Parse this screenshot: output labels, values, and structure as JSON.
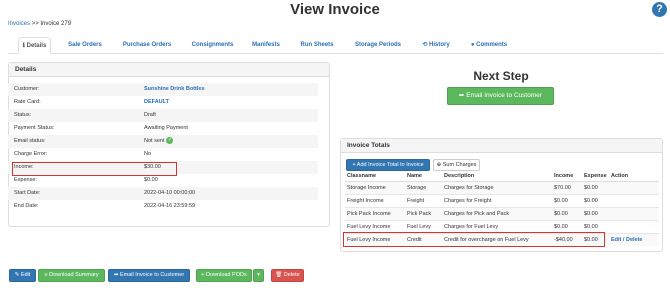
{
  "page": {
    "title": "View Invoice",
    "help_icon": "?"
  },
  "breadcrumb": {
    "root": "Invoices",
    "separator": ">>",
    "current": "Invoice 279"
  },
  "tabs": [
    {
      "icon": "ℹ",
      "label": "Details",
      "active": true
    },
    {
      "label": "Sale Orders"
    },
    {
      "label": "Purchase Orders"
    },
    {
      "label": "Consignments"
    },
    {
      "label": "Manifests"
    },
    {
      "label": "Run Sheets"
    },
    {
      "label": "Storage Periods"
    },
    {
      "icon": "⟲",
      "label": "History"
    },
    {
      "icon": "●",
      "label": "Comments"
    }
  ],
  "details": {
    "heading": "Details",
    "rows": [
      {
        "label": "Customer:",
        "value": "Sunshine Drink Bottles",
        "link": true
      },
      {
        "label": "Rate Card:",
        "value": "DEFAULT",
        "link": true
      },
      {
        "label": "Status:",
        "value": "Draft"
      },
      {
        "label": "Payment Status:",
        "value": "Awaiting Payment"
      },
      {
        "label": "Email status:",
        "value": "Not sent",
        "icon": "check-circle-icon",
        "icon_color": "#5cb85c"
      },
      {
        "label": "Charge Error:",
        "value": "No"
      },
      {
        "label": "Income:",
        "value": "$30.00",
        "highlighted": true
      },
      {
        "label": "Expense:",
        "value": "$0.00"
      },
      {
        "label": "Start Date:",
        "value": "2022-04-10 00:00:00"
      },
      {
        "label": "End Date:",
        "value": "2022-04-16 23:59:59"
      }
    ]
  },
  "next_step": {
    "heading": "Next Step",
    "button_label": "Email Invoice to Customer"
  },
  "invoice_totals": {
    "heading": "Invoice Totals",
    "add_button": "Add Invoice Total to Invoice",
    "sum_button": "Sum Charges",
    "columns": [
      "Classname",
      "Name",
      "Description",
      "Income",
      "Expense",
      "Action"
    ],
    "rows": [
      {
        "classname": "Storage Income",
        "name": "Storage",
        "description": "Charges for Storage",
        "income": "$70.00",
        "expense": "$0.00",
        "action": ""
      },
      {
        "classname": "Freight Income",
        "name": "Freight",
        "description": "Charges for Freight",
        "income": "$0.00",
        "expense": "$0.00",
        "action": ""
      },
      {
        "classname": "Pick Pack Income",
        "name": "Pick Pack",
        "description": "Charges for Pick and Pack",
        "income": "$0.00",
        "expense": "$0.00",
        "action": ""
      },
      {
        "classname": "Fuel Levy Income",
        "name": "Fuel Levy",
        "description": "Charges for Fuel Levy",
        "income": "$0.00",
        "expense": "$0.00",
        "action": ""
      },
      {
        "classname": "Fuel Levy Income",
        "name": "Credit",
        "description": "Credit for overcharge on Fuel Levy",
        "income": "-$40.00",
        "expense": "$0.00",
        "action": "Edit / Delete",
        "highlighted": true
      }
    ]
  },
  "footer_buttons": {
    "edit": "Edit",
    "download_summary": "Download Summary",
    "email": "Email Invoice to Customer",
    "download_pods": "Download PODs",
    "delete": "Delete"
  },
  "colors": {
    "primary": "#3276b1",
    "success": "#5cb85c",
    "danger": "#d9534f",
    "link": "#2a6fb3",
    "highlight_box": "#d9342b"
  }
}
